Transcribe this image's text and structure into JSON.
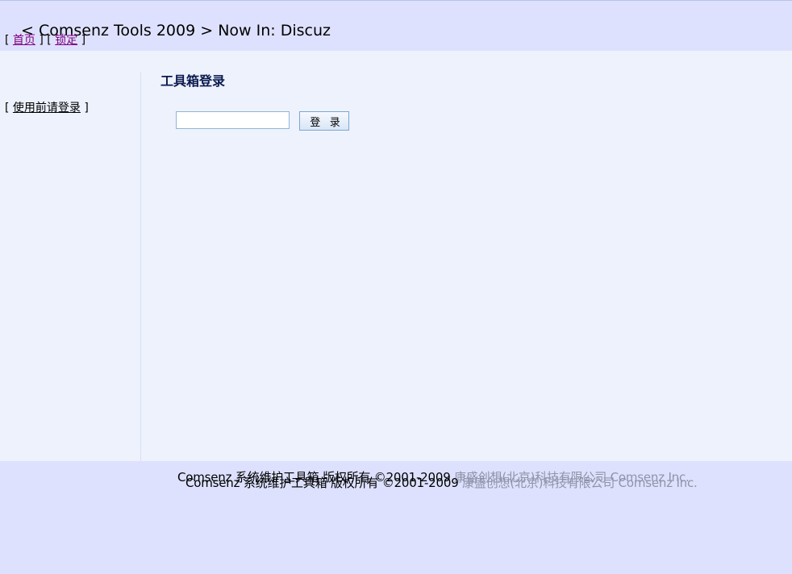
{
  "header": {
    "title": "< Comsenz Tools 2009 > Now In: Discuz",
    "nav": {
      "open_bracket_1": "[",
      "home_label": "首页",
      "separator": "] [",
      "lock_label": "锁定",
      "close_bracket_2": "]"
    }
  },
  "sidebar": {
    "open_bracket": "[",
    "login_prompt": "使用前请登录",
    "close_bracket": "]"
  },
  "main": {
    "title": "工具箱登录",
    "password_value": "",
    "login_button": "登 录"
  },
  "footer": {
    "text": "Comsenz 系统维护工具箱 版权所有 ©2001-2009 ",
    "company": "康盛创想(北京)科技有限公司 Comsenz Inc."
  }
}
